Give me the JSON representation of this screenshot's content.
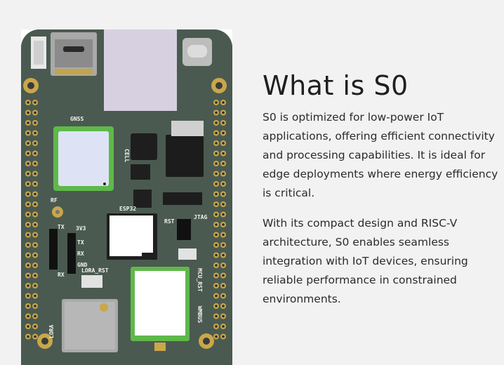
{
  "board": {
    "alt": "S0 development board",
    "silk": {
      "gnss": "GNSS",
      "cell": "CELL",
      "rf": "RF",
      "esp32": "ESP32",
      "jtag": "JTAG",
      "tx": "TX",
      "rx": "RX",
      "v33": "3V3",
      "gnd": "GND",
      "tx2": "TX",
      "rx2": "RX",
      "lora_rst": "LORA_RST",
      "lora": "LORA",
      "mcu_rst": "MCU_RST",
      "wmbus": "WMBUS",
      "rst": "RST"
    }
  },
  "content": {
    "title": "What is S0",
    "paragraph1": "S0 is optimized for low-power IoT applications, offering efficient connectivity and processing capabilities. It is ideal for edge deployments where energy efficiency is critical.",
    "paragraph2": "With its compact design and RISC-V architecture, S0 enables seamless integration with IoT devices, ensuring reliable performance in constrained environments."
  }
}
